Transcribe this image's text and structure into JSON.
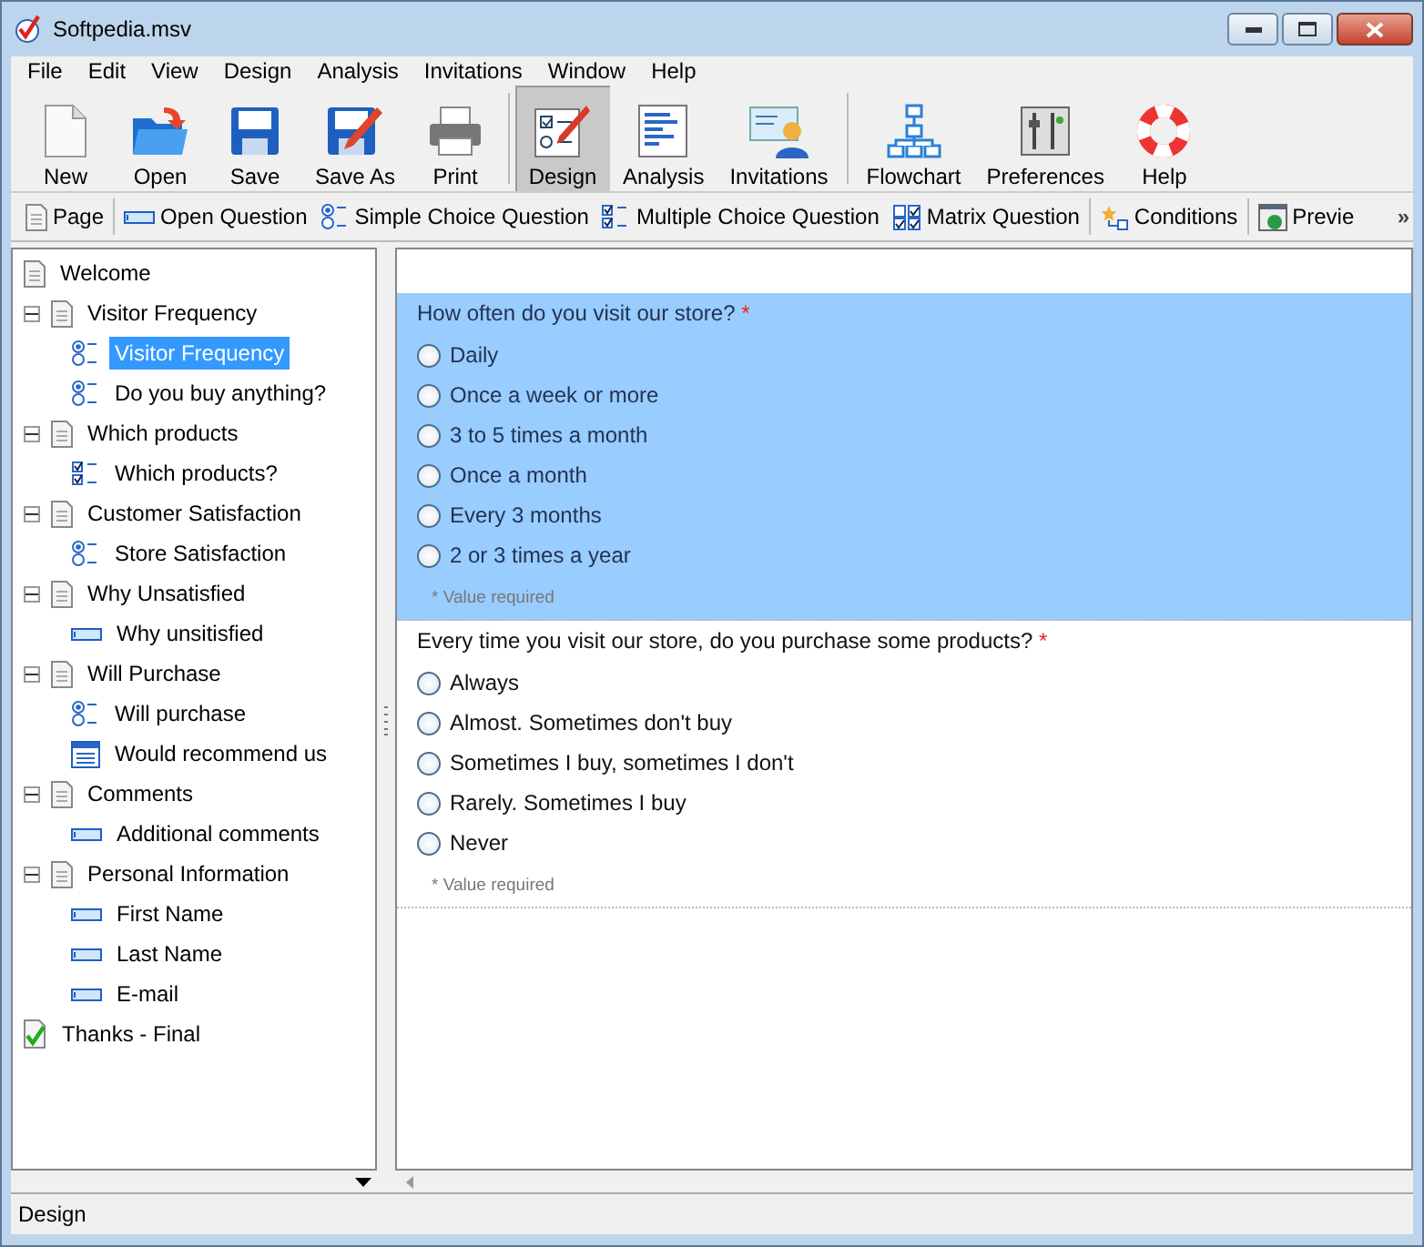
{
  "window": {
    "title": "Softpedia.msv"
  },
  "menu": [
    "File",
    "Edit",
    "View",
    "Design",
    "Analysis",
    "Invitations",
    "Window",
    "Help"
  ],
  "toolbar": [
    {
      "label": "New",
      "kind": "new",
      "selected": false
    },
    {
      "label": "Open",
      "kind": "open",
      "selected": false
    },
    {
      "label": "Save",
      "kind": "save",
      "selected": false
    },
    {
      "label": "Save As",
      "kind": "saveas",
      "selected": false
    },
    {
      "label": "Print",
      "kind": "print",
      "selected": false
    },
    {
      "label": "Design",
      "kind": "design",
      "selected": true
    },
    {
      "label": "Analysis",
      "kind": "analysis",
      "selected": false
    },
    {
      "label": "Invitations",
      "kind": "invitations",
      "selected": false
    },
    {
      "label": "Flowchart",
      "kind": "flowchart",
      "selected": false
    },
    {
      "label": "Preferences",
      "kind": "preferences",
      "selected": false
    },
    {
      "label": "Help",
      "kind": "help",
      "selected": false
    }
  ],
  "insert_bar": [
    {
      "label": "Page",
      "kind": "page"
    },
    {
      "label": "Open Question",
      "kind": "text"
    },
    {
      "label": "Simple Choice Question",
      "kind": "single"
    },
    {
      "label": "Multiple Choice Question",
      "kind": "multi"
    },
    {
      "label": "Matrix Question",
      "kind": "matrix"
    },
    {
      "label": "Conditions",
      "kind": "conditions"
    },
    {
      "label": "Previe",
      "kind": "preview"
    }
  ],
  "insert_bar_overflow": "»",
  "tree": [
    {
      "label": "Welcome",
      "kind": "page",
      "selected": false
    },
    {
      "label": "Visitor Frequency",
      "kind": "page",
      "expanded": true,
      "selected": false,
      "children": [
        {
          "label": "Visitor Frequency",
          "kind": "single",
          "selected": true
        },
        {
          "label": "Do you buy anything?",
          "kind": "single",
          "selected": false
        }
      ]
    },
    {
      "label": "Which products",
      "kind": "page",
      "expanded": true,
      "selected": false,
      "children": [
        {
          "label": "Which products?",
          "kind": "multi",
          "selected": false
        }
      ]
    },
    {
      "label": "Customer Satisfaction",
      "kind": "page",
      "expanded": true,
      "selected": false,
      "children": [
        {
          "label": "Store Satisfaction",
          "kind": "single",
          "selected": false
        }
      ]
    },
    {
      "label": "Why Unsatisfied",
      "kind": "page",
      "expanded": true,
      "selected": false,
      "children": [
        {
          "label": "Why unsitisfied",
          "kind": "text",
          "selected": false
        }
      ]
    },
    {
      "label": "Will Purchase",
      "kind": "page",
      "expanded": true,
      "selected": false,
      "children": [
        {
          "label": "Will purchase",
          "kind": "single",
          "selected": false
        },
        {
          "label": "Would recommend us",
          "kind": "memo",
          "selected": false
        }
      ]
    },
    {
      "label": "Comments",
      "kind": "page",
      "expanded": true,
      "selected": false,
      "children": [
        {
          "label": "Additional comments",
          "kind": "text",
          "selected": false
        }
      ]
    },
    {
      "label": "Personal Information",
      "kind": "page",
      "expanded": true,
      "selected": false,
      "children": [
        {
          "label": "First Name",
          "kind": "text",
          "selected": false
        },
        {
          "label": "Last Name",
          "kind": "text",
          "selected": false
        },
        {
          "label": "E-mail",
          "kind": "text",
          "selected": false
        }
      ]
    },
    {
      "label": "Thanks - Final",
      "kind": "final",
      "selected": false
    }
  ],
  "questions": [
    {
      "text": "How often do you visit our store?",
      "required_mark": "*",
      "selected": true,
      "note": "* Value required",
      "options": [
        {
          "label": "Daily",
          "checked": false
        },
        {
          "label": "Once a week or more",
          "checked": false
        },
        {
          "label": "3 to 5 times a month",
          "checked": false
        },
        {
          "label": "Once a month",
          "checked": false
        },
        {
          "label": "Every 3 months",
          "checked": false
        },
        {
          "label": "2 or 3 times a year",
          "checked": false
        }
      ]
    },
    {
      "text": "Every time you visit our store, do you purchase some products?",
      "required_mark": "*",
      "selected": false,
      "note": "* Value required",
      "options": [
        {
          "label": "Always",
          "checked": false
        },
        {
          "label": "Almost. Sometimes don't buy",
          "checked": false
        },
        {
          "label": "Sometimes I buy, sometimes I don't",
          "checked": false
        },
        {
          "label": "Rarely. Sometimes I buy",
          "checked": false
        },
        {
          "label": "Never",
          "checked": false
        }
      ]
    }
  ],
  "status_bar": "Design"
}
